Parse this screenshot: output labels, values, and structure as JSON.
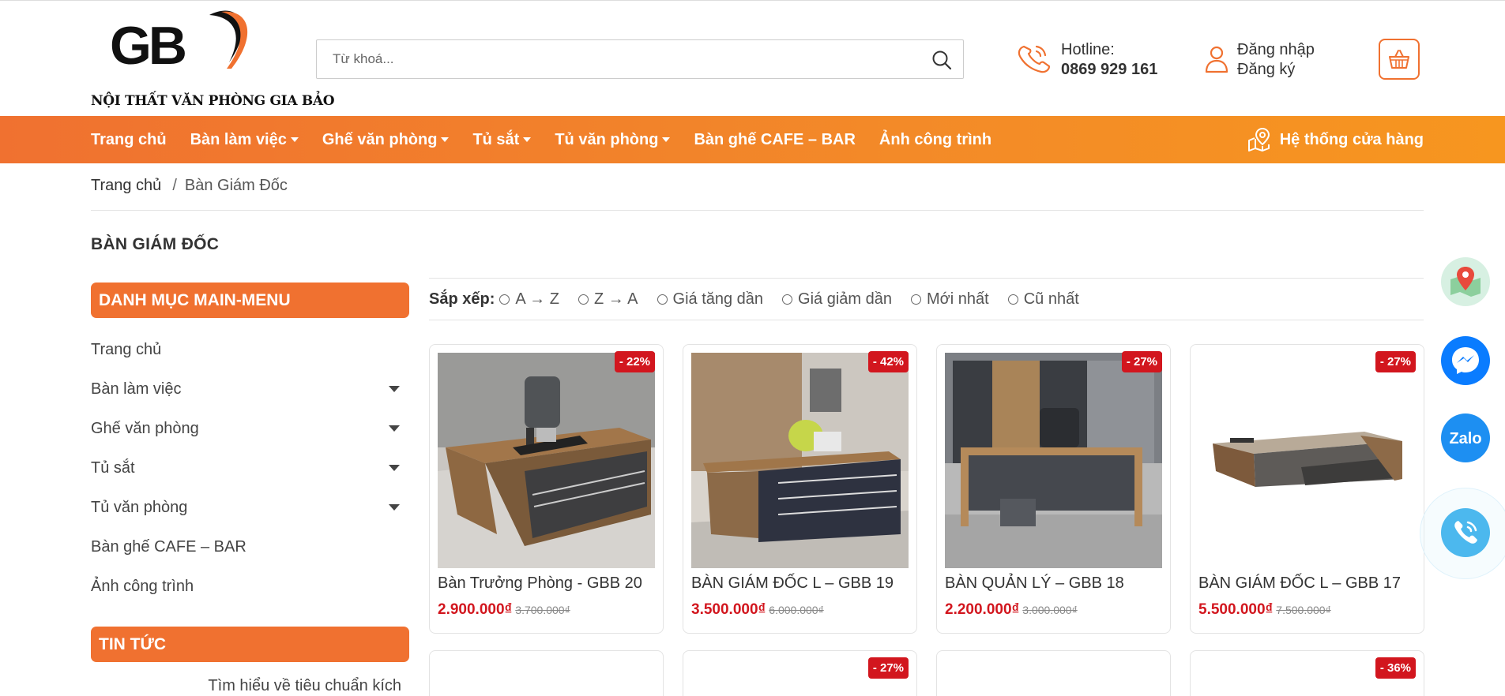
{
  "header": {
    "logo_tagline": "NỘI THẤT VĂN PHÒNG GIA BẢO",
    "search_placeholder": "Từ khoá...",
    "hotline_label": "Hotline:",
    "hotline_number": "0869 929 161",
    "login_label": "Đăng nhập",
    "register_label": "Đăng ký"
  },
  "nav": {
    "items": [
      {
        "label": "Trang chủ",
        "dropdown": false
      },
      {
        "label": "Bàn làm việc",
        "dropdown": true
      },
      {
        "label": "Ghế văn phòng",
        "dropdown": true
      },
      {
        "label": "Tủ sắt",
        "dropdown": true
      },
      {
        "label": "Tủ văn phòng",
        "dropdown": true
      },
      {
        "label": "Bàn ghế CAFE – BAR",
        "dropdown": false
      },
      {
        "label": "Ảnh công trình",
        "dropdown": false
      }
    ],
    "stores_label": "Hệ thống cửa hàng"
  },
  "breadcrumb": {
    "home": "Trang chủ",
    "separator": "/",
    "current": "Bàn Giám Đốc"
  },
  "page_title": "BÀN GIÁM ĐỐC",
  "sidebar": {
    "menu_title": "DANH MỤC MAIN-MENU",
    "items": [
      {
        "label": "Trang chủ",
        "expandable": false
      },
      {
        "label": "Bàn làm việc",
        "expandable": true
      },
      {
        "label": "Ghế văn phòng",
        "expandable": true
      },
      {
        "label": "Tủ sắt",
        "expandable": true
      },
      {
        "label": "Tủ văn phòng",
        "expandable": true
      },
      {
        "label": "Bàn ghế CAFE – BAR",
        "expandable": false
      },
      {
        "label": "Ảnh công trình",
        "expandable": false
      }
    ],
    "news_title": "TIN TỨC",
    "news_first_item": "Tìm hiểu về tiêu chuẩn kích"
  },
  "sort": {
    "label": "Sắp xếp:",
    "options": [
      "A → Z",
      "Z → A",
      "Giá tăng dần",
      "Giá giảm dần",
      "Mới nhất",
      "Cũ nhất"
    ]
  },
  "products": [
    {
      "name": "Bàn Trưởng Phòng - GBB 20",
      "price": "2.900.000₫",
      "old_price": "3.700.000₫",
      "discount": "- 22%"
    },
    {
      "name": "BÀN GIÁM ĐỐC L – GBB 19",
      "price": "3.500.000₫",
      "old_price": "6.000.000₫",
      "discount": "- 42%"
    },
    {
      "name": "BÀN QUẢN LÝ – GBB 18",
      "price": "2.200.000₫",
      "old_price": "3.000.000₫",
      "discount": "- 27%"
    },
    {
      "name": "BÀN GIÁM ĐỐC L – GBB 17",
      "price": "5.500.000₫",
      "old_price": "7.500.000₫",
      "discount": "- 27%"
    }
  ],
  "products_row2_badges": [
    "",
    "- 27%",
    "",
    "- 36%"
  ],
  "floating": {
    "zalo_label": "Zalo"
  },
  "colors": {
    "brand_orange": "#f07130",
    "price_red": "#d2161e",
    "messenger_blue": "#0a7cff",
    "zalo_blue": "#1d8ff2"
  }
}
